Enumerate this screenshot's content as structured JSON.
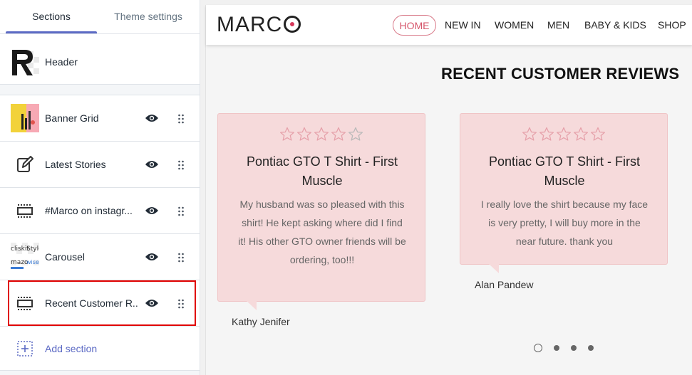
{
  "sidebar": {
    "tabs": [
      {
        "label": "Sections",
        "active": true
      },
      {
        "label": "Theme settings",
        "active": false
      }
    ],
    "header_section": {
      "label": "Header"
    },
    "sections": [
      {
        "label": "Banner Grid",
        "thumb": "banner-thumbnail"
      },
      {
        "label": "Latest Stories",
        "thumb": "edit-icon"
      },
      {
        "label": "#Marco on instagr...",
        "thumb": "section-placeholder-icon"
      },
      {
        "label": "Carousel",
        "thumb": "carousel-thumbnail"
      },
      {
        "label": "Recent Customer R...",
        "thumb": "section-placeholder-icon",
        "selected": true
      }
    ],
    "add_section": {
      "label": "Add section"
    },
    "carousel_thumb_text": [
      "cliskit",
      "Style",
      "mazo",
      "wise"
    ]
  },
  "preview": {
    "logo": {
      "text": "MARC"
    },
    "nav": [
      "HOME",
      "NEW IN",
      "WOMEN",
      "MEN",
      "BABY & KIDS",
      "SHOP"
    ],
    "reviews_title": "RECENT CUSTOMER REVIEWS",
    "reviews": [
      {
        "rating": 4,
        "title": "Pontiac GTO T Shirt - First Muscle",
        "text": "My husband was so pleased with this shirt! He kept asking where did I find it! His other GTO owner friends will be ordering, too!!!",
        "author": "Kathy Jenifer"
      },
      {
        "rating": 5,
        "title": "Pontiac GTO T Shirt - First Muscle",
        "text": "I really love the shirt because my face is very pretty, I will buy more in the near future. thank you",
        "author": "Alan Pandew"
      }
    ],
    "pager": {
      "pages": 4,
      "active": 1
    }
  },
  "colors": {
    "accent": "#5c6ac4",
    "selection": "#e00000",
    "card_bg": "#f6dadb",
    "star": "#e6a1aa",
    "home_pill": "#d6566b"
  }
}
